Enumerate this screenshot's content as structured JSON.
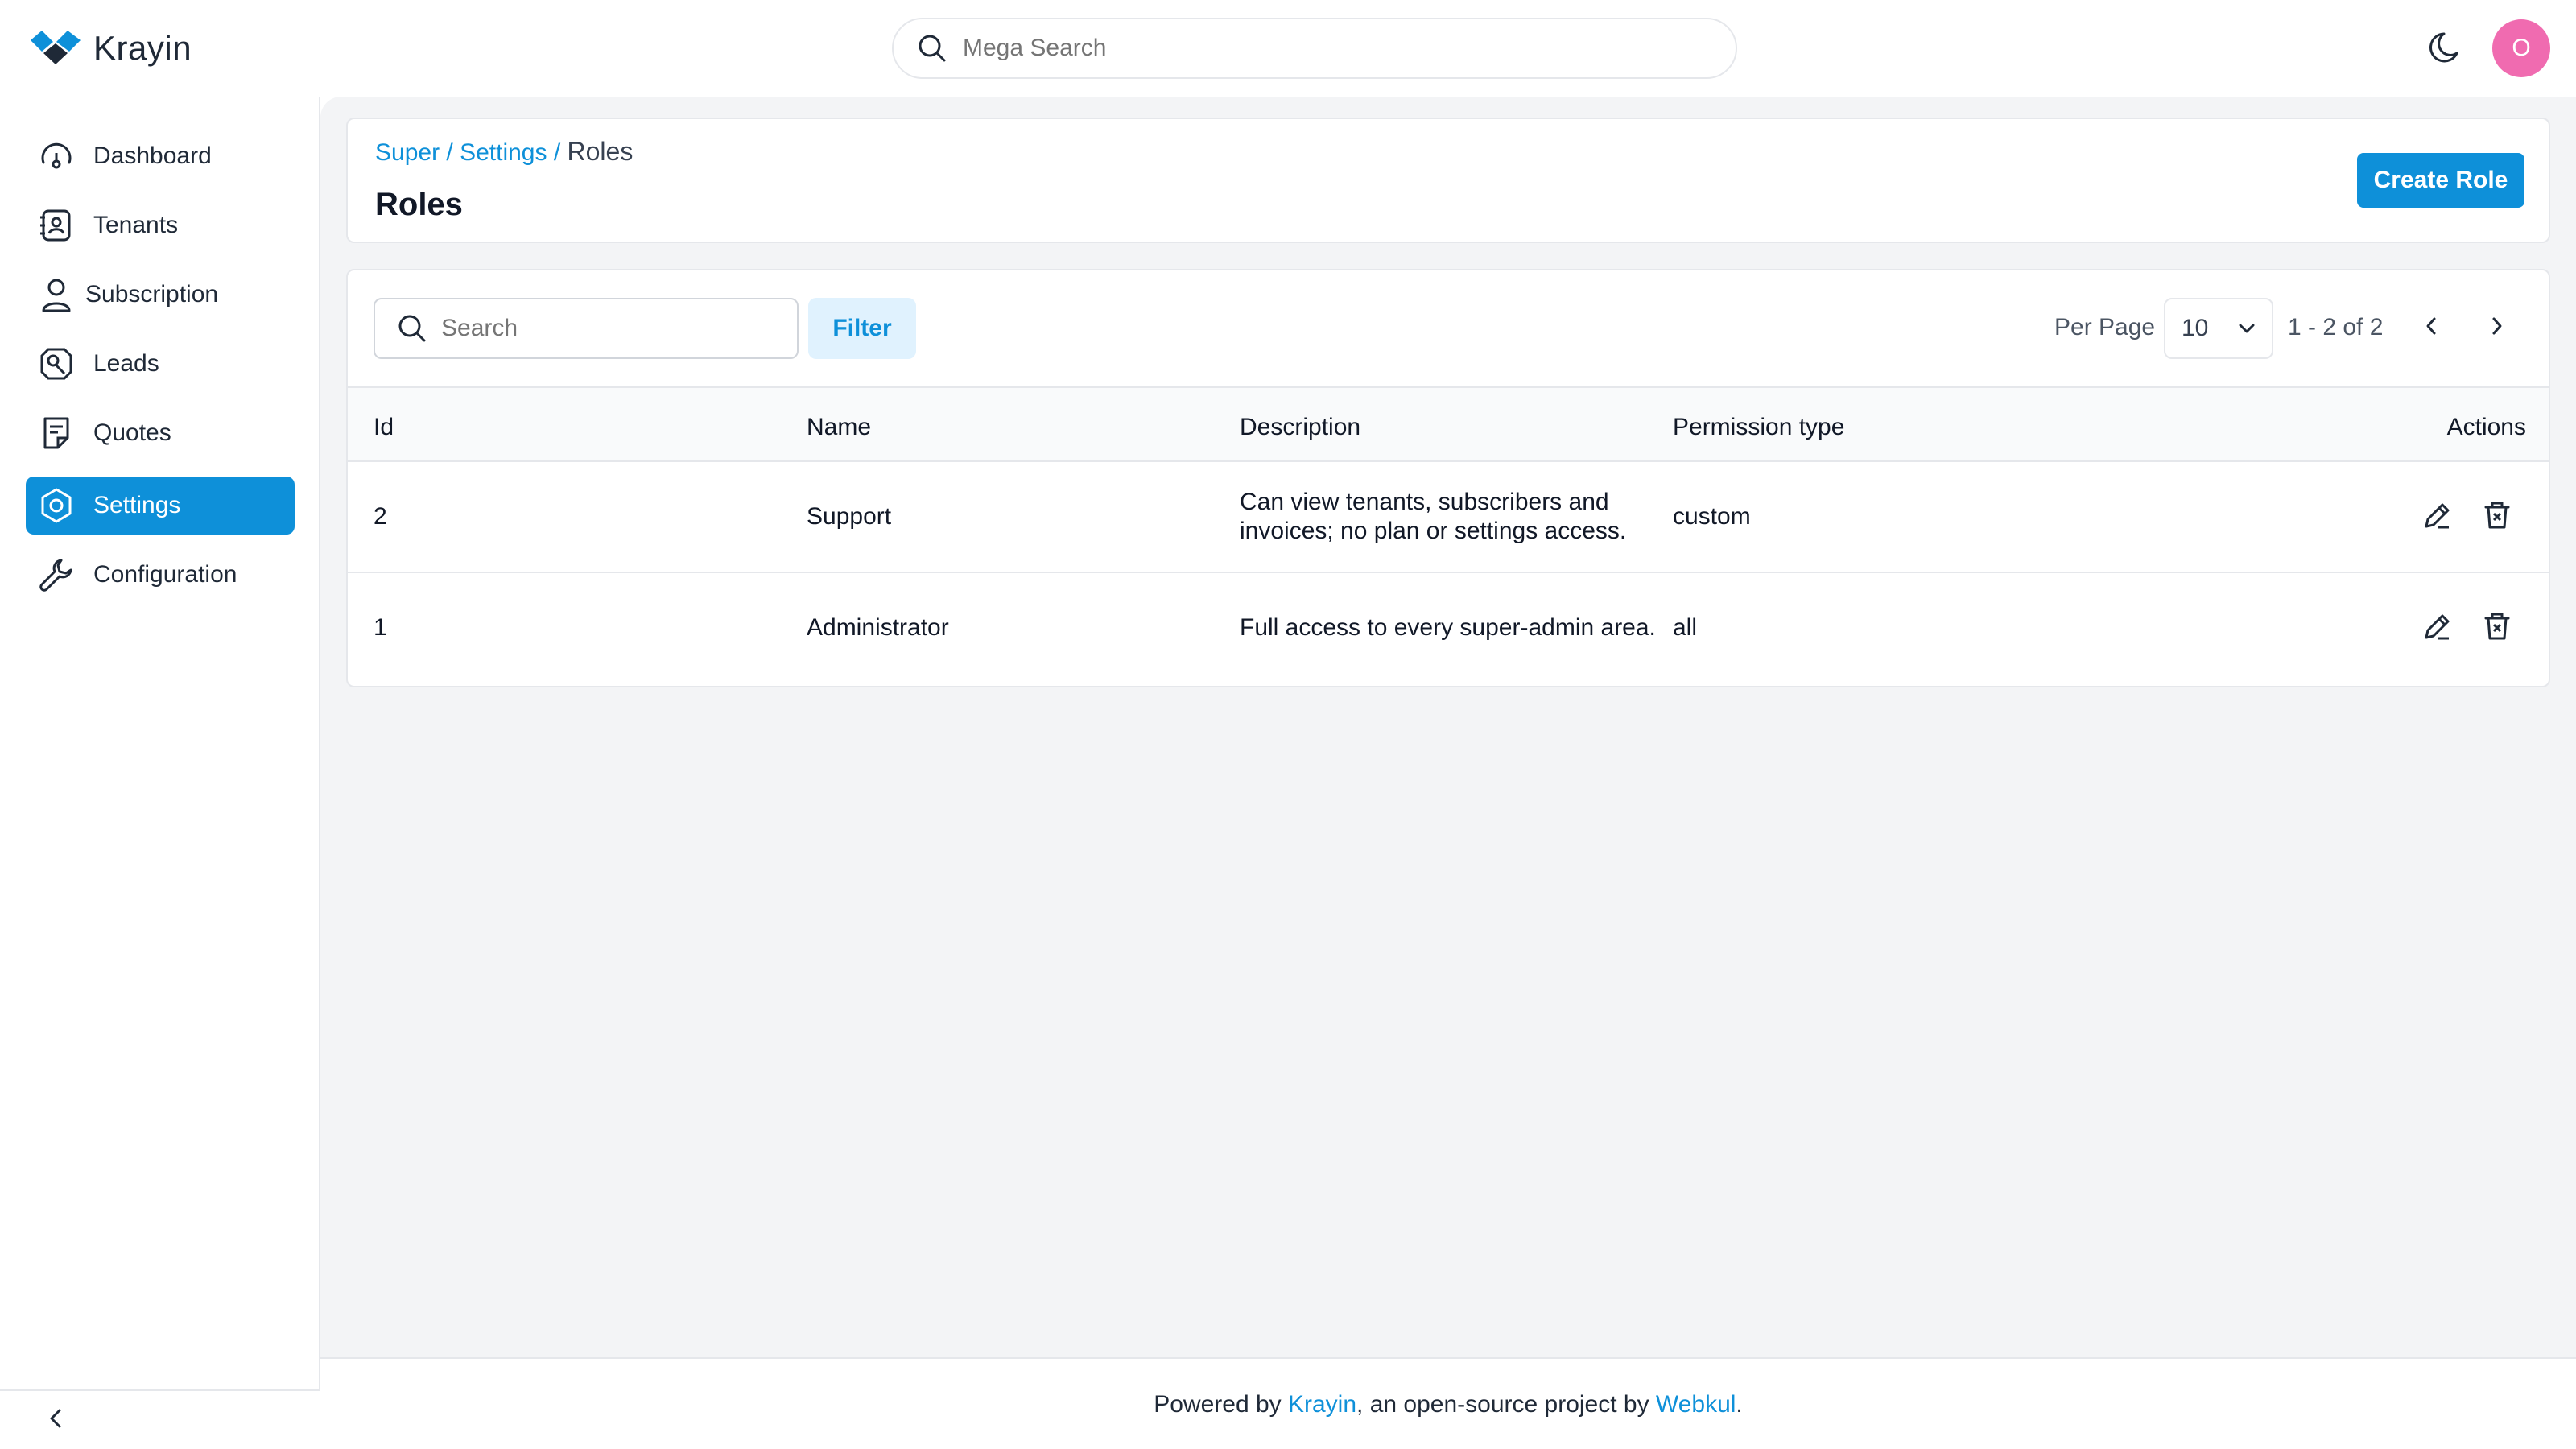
{
  "app": {
    "name": "Krayin"
  },
  "topbar": {
    "search_placeholder": "Mega Search",
    "avatar_initial": "O"
  },
  "sidebar": {
    "items": [
      {
        "label": "Dashboard",
        "icon": "dashboard-icon",
        "active": false
      },
      {
        "label": "Tenants",
        "icon": "tenants-icon",
        "active": false
      },
      {
        "label": "Subscription",
        "icon": "user-icon",
        "active": false
      },
      {
        "label": "Leads",
        "icon": "leads-icon",
        "active": false
      },
      {
        "label": "Quotes",
        "icon": "quotes-icon",
        "active": false
      },
      {
        "label": "Settings",
        "icon": "settings-icon",
        "active": true
      },
      {
        "label": "Configuration",
        "icon": "wrench-icon",
        "active": false
      }
    ]
  },
  "header": {
    "breadcrumb": [
      "Super",
      "Settings",
      "Roles"
    ],
    "title": "Roles",
    "create_label": "Create Role"
  },
  "toolbar": {
    "search_placeholder": "Search",
    "filter_label": "Filter",
    "per_page_label": "Per Page",
    "per_page_value": "10",
    "page_info": "1 - 2 of 2"
  },
  "table": {
    "columns": [
      "Id",
      "Name",
      "Description",
      "Permission type",
      "Actions"
    ],
    "rows": [
      {
        "id": "2",
        "name": "Support",
        "description_line1": "Can view tenants, subscribers and",
        "description_line2": "invoices; no plan or settings access.",
        "permission_type": "custom"
      },
      {
        "id": "1",
        "name": "Administrator",
        "description_line1": "Full access to every super-admin area.",
        "description_line2": "",
        "permission_type": "all"
      }
    ]
  },
  "footer": {
    "prefix": "Powered by ",
    "brand": "Krayin",
    "middle": ", an open-source project by ",
    "company": "Webkul",
    "suffix": "."
  },
  "colors": {
    "accent": "#0e90d9",
    "avatar": "#f06bb0",
    "background": "#f3f4f6"
  }
}
